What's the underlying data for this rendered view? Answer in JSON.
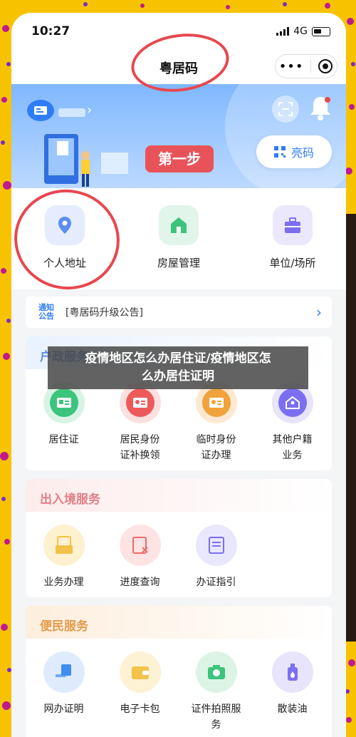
{
  "status_bar": {
    "time": "10:27",
    "network": "4G"
  },
  "nav": {
    "title": "粤居码"
  },
  "banner": {
    "step_label": "第一步",
    "bright_code_label": "亮码"
  },
  "quick_actions": [
    {
      "label": "个人地址",
      "icon": "location-icon",
      "color": "#5b8def"
    },
    {
      "label": "房屋管理",
      "icon": "house-icon",
      "color": "#3cc47c"
    },
    {
      "label": "单位/场所",
      "icon": "briefcase-icon",
      "color": "#7a6ff0"
    }
  ],
  "notice": {
    "badge_line1": "通知",
    "badge_line2": "公告",
    "text": "[粤居码升级公告]"
  },
  "sections": {
    "household": {
      "title": "户政服务",
      "items": [
        {
          "line1": "居住证",
          "line2": "",
          "icon": "id-card-icon",
          "color": "#3cc47c"
        },
        {
          "line1": "居民身份",
          "line2": "证补换领",
          "icon": "badge-icon",
          "color": "#ee5a5a"
        },
        {
          "line1": "临时身份",
          "line2": "证办理",
          "icon": "temp-id-icon",
          "color": "#f0a23c"
        },
        {
          "line1": "其他户籍",
          "line2": "业务",
          "icon": "home-user-icon",
          "color": "#7a6ff0"
        }
      ]
    },
    "entry_exit": {
      "title": "出入境服务",
      "items": [
        {
          "line1": "业务办理",
          "line2": "",
          "icon": "inbox-icon",
          "color": "#f3c24a"
        },
        {
          "line1": "进度查询",
          "line2": "",
          "icon": "doc-x-icon",
          "color": "#ee6a6a"
        },
        {
          "line1": "办证指引",
          "line2": "",
          "icon": "guide-icon",
          "color": "#7a6ff0"
        }
      ]
    },
    "convenience": {
      "title": "便民服务",
      "items": [
        {
          "line1": "网办证明",
          "line2": "",
          "icon": "hand-doc-icon",
          "color": "#3f8df0"
        },
        {
          "line1": "电子卡包",
          "line2": "",
          "icon": "wallet-icon",
          "color": "#f3c24a"
        },
        {
          "line1": "证件拍照服",
          "line2": "务",
          "icon": "camera-icon",
          "color": "#3cc47c"
        },
        {
          "line1": "散装油",
          "line2": "",
          "icon": "oil-bottle-icon",
          "color": "#7a6ff0"
        }
      ]
    }
  },
  "caption": {
    "line1": "疫情地区怎么办居住证/疫情地区怎",
    "line2": "么办居住证明"
  }
}
